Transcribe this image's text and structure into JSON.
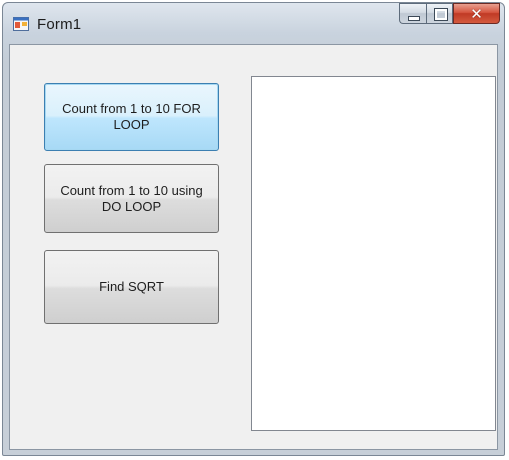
{
  "window": {
    "title": "Form1",
    "icon": "form-app-icon",
    "caption_buttons": [
      "minimize-icon",
      "maximize-icon",
      "close-icon"
    ]
  },
  "buttons": {
    "for_loop": "Count from 1 to 10 FOR LOOP",
    "do_loop": "Count from 1 to 10 using DO LOOP",
    "sqrt": "Find SQRT"
  },
  "listbox": {
    "items": []
  },
  "colors": {
    "client_bg": "#f0f0f0",
    "focus_border": "#3c7fb1",
    "close_button": "#c03a25"
  }
}
